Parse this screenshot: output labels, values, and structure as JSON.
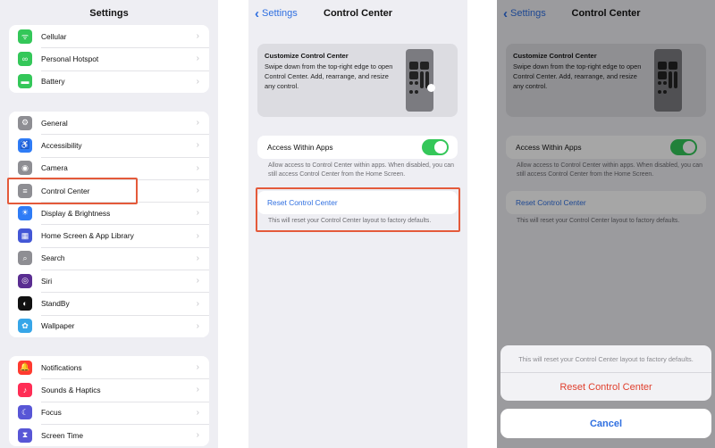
{
  "settings": {
    "title": "Settings",
    "group1": [
      {
        "label": "Cellular",
        "icon": "antenna-icon",
        "color": "#34c759",
        "glyph": "ᯤ"
      },
      {
        "label": "Personal Hotspot",
        "icon": "link-icon",
        "color": "#34c759",
        "glyph": "∞"
      },
      {
        "label": "Battery",
        "icon": "battery-icon",
        "color": "#34c759",
        "glyph": "▬"
      }
    ],
    "group2": [
      {
        "label": "General",
        "icon": "gear-icon",
        "color": "#8e8e93",
        "glyph": "⚙"
      },
      {
        "label": "Accessibility",
        "icon": "accessibility-icon",
        "color": "#2f7cf6",
        "glyph": "♿"
      },
      {
        "label": "Camera",
        "icon": "camera-icon",
        "color": "#8e8e93",
        "glyph": "◉"
      },
      {
        "label": "Control Center",
        "icon": "switches-icon",
        "color": "#8e8e93",
        "glyph": "≡"
      },
      {
        "label": "Display & Brightness",
        "icon": "sun-icon",
        "color": "#2f7cf6",
        "glyph": "☀"
      },
      {
        "label": "Home Screen & App Library",
        "icon": "home-screen-icon",
        "color": "#4357d6",
        "glyph": "▦"
      },
      {
        "label": "Search",
        "icon": "search-icon",
        "color": "#8e8e93",
        "glyph": "⌕"
      },
      {
        "label": "Siri",
        "icon": "siri-icon",
        "color": "#5a2d91",
        "glyph": "◎"
      },
      {
        "label": "StandBy",
        "icon": "standby-icon",
        "color": "#111111",
        "glyph": "◐"
      },
      {
        "label": "Wallpaper",
        "icon": "flower-icon",
        "color": "#37a6e8",
        "glyph": "✿"
      }
    ],
    "group3": [
      {
        "label": "Notifications",
        "icon": "bell-icon",
        "color": "#ff3b30",
        "glyph": "🔔"
      },
      {
        "label": "Sounds & Haptics",
        "icon": "speaker-icon",
        "color": "#ff2d55",
        "glyph": "♪"
      },
      {
        "label": "Focus",
        "icon": "moon-icon",
        "color": "#5856d6",
        "glyph": "☾"
      },
      {
        "label": "Screen Time",
        "icon": "hourglass-icon",
        "color": "#5856d6",
        "glyph": "⧗"
      }
    ]
  },
  "control_center": {
    "back_label": "Settings",
    "title": "Control Center",
    "customize_title": "Customize Control Center",
    "customize_desc": "Swipe down from the top-right edge to open Control Center. Add, rearrange, and resize any control.",
    "access_label": "Access Within Apps",
    "access_on": true,
    "access_desc": "Allow access to Control Center within apps. When disabled, you can still access Control Center from the Home Screen.",
    "reset_label": "Reset Control Center",
    "reset_desc": "This will reset your Control Center layout to factory defaults."
  },
  "action_sheet": {
    "message": "This will reset your Control Center layout to factory defaults.",
    "confirm_label": "Reset Control Center",
    "cancel_label": "Cancel"
  },
  "colors": {
    "accent": "#2f6fe0",
    "highlight": "#e45a3a",
    "toggle_on": "#34c759",
    "destructive": "#e0402e"
  }
}
